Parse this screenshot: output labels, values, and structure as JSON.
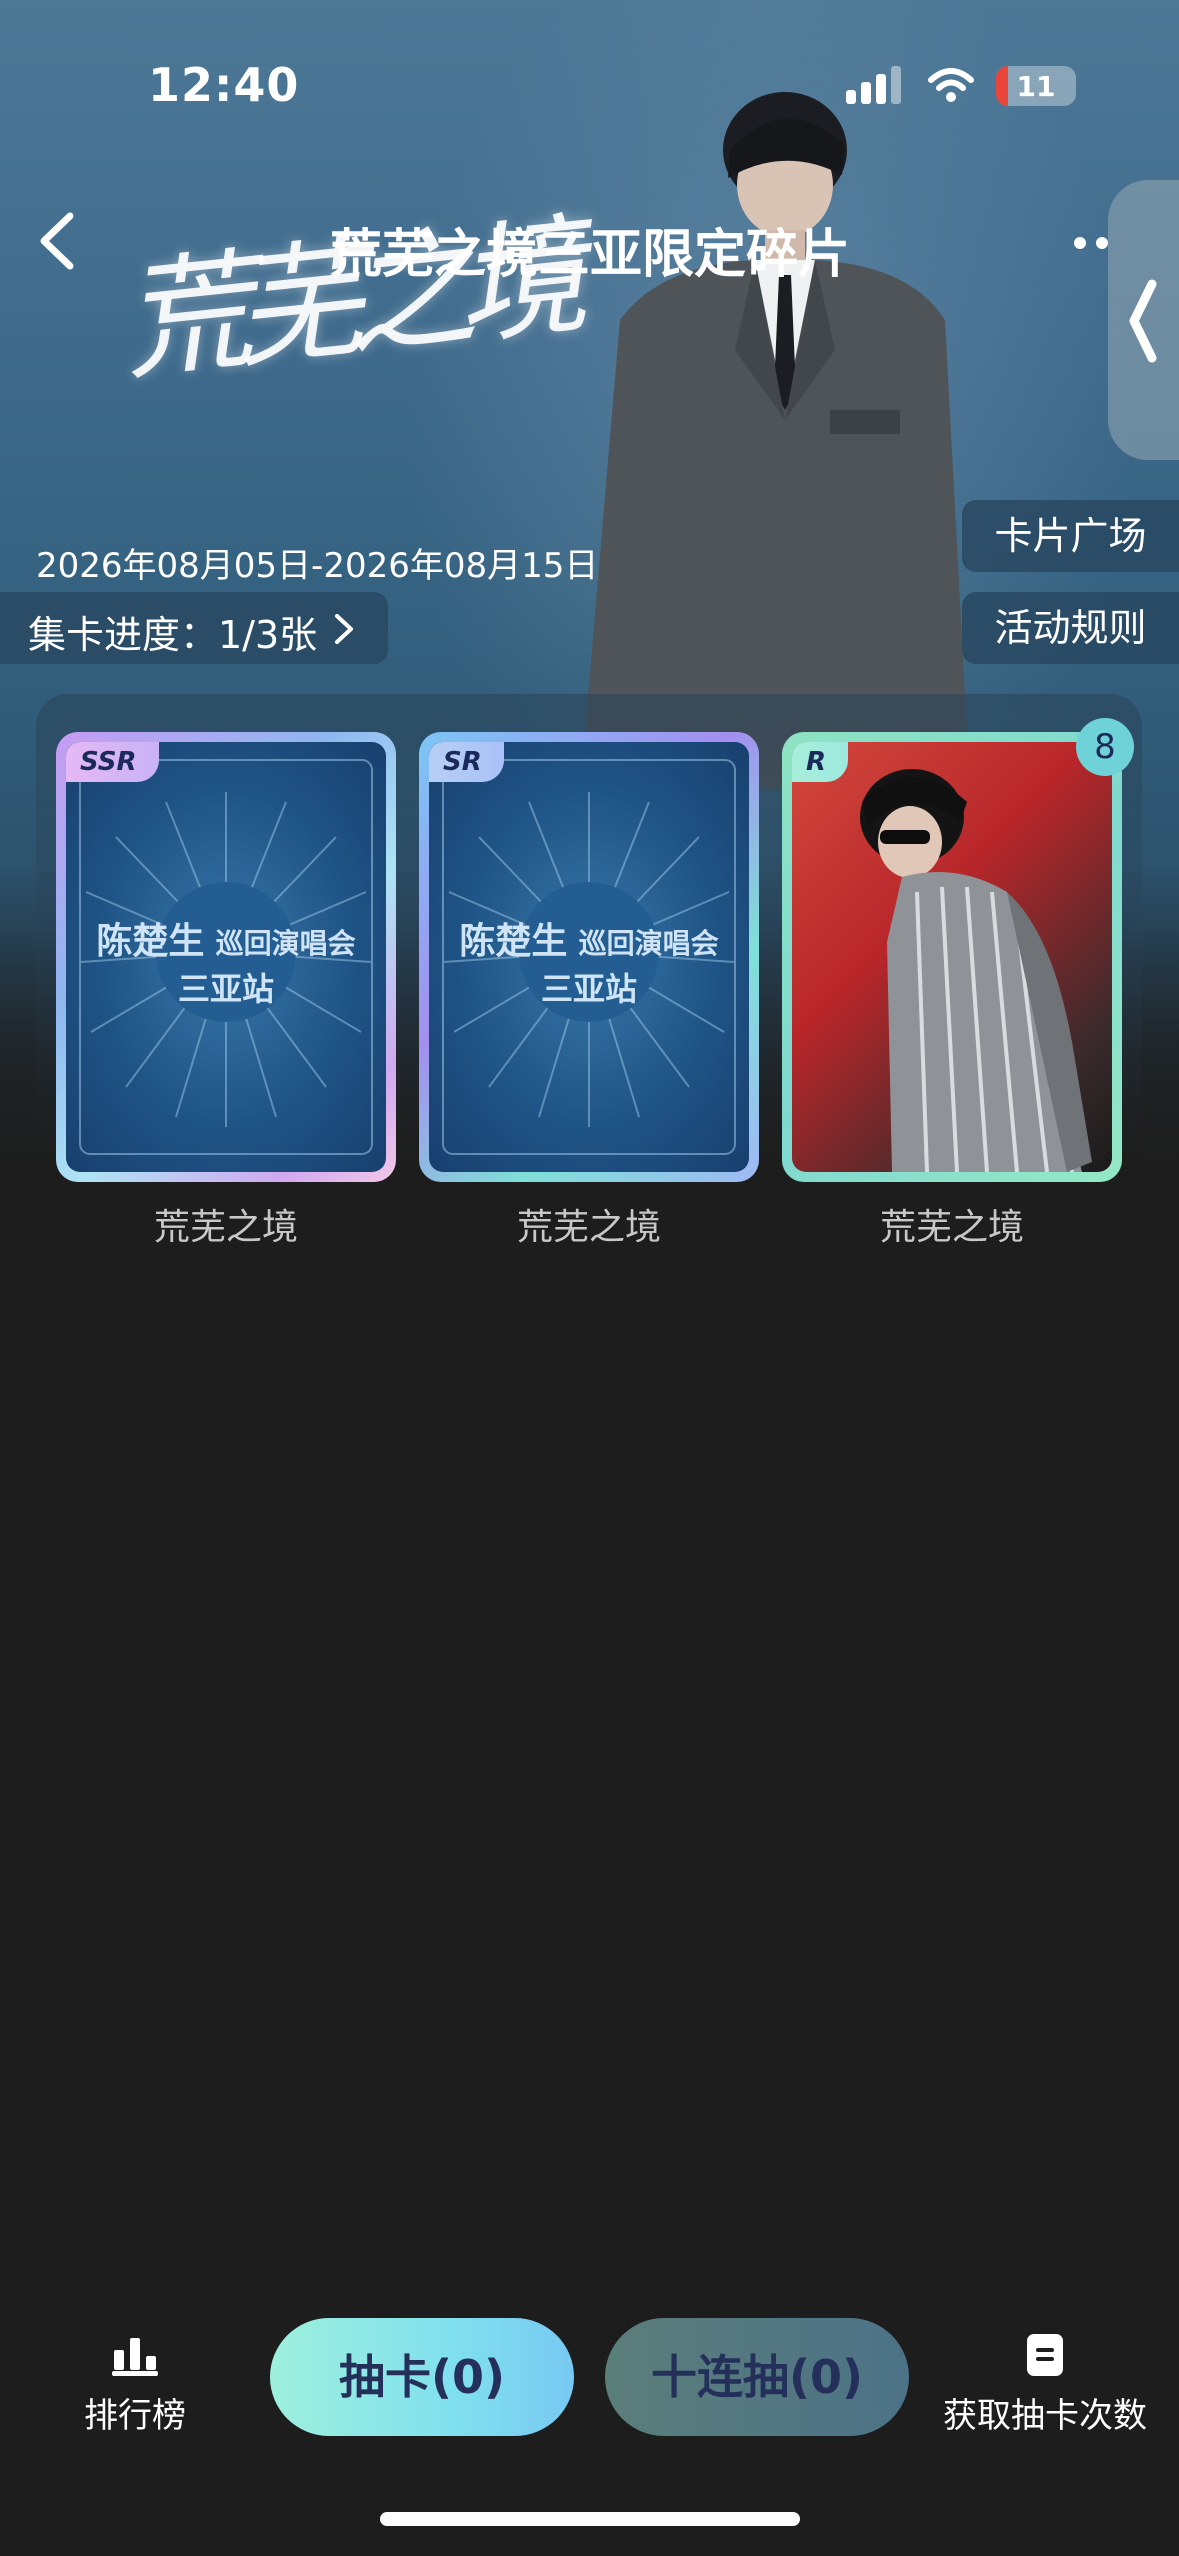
{
  "status_bar": {
    "time": "12:40",
    "battery": "11"
  },
  "header": {
    "title": "荒芜之境三亚限定碎片",
    "calligraphy": "荒芜之境",
    "date_range": "2026年08月05日-2026年08月15日",
    "progress_label": "集卡进度：1/3张",
    "plaza_button": "卡片广场",
    "rules_button": "活动规则"
  },
  "cards": [
    {
      "rarity": "SSR",
      "line1_a": "陈楚生",
      "line1_b": "巡回演唱会",
      "line2": "三亚站",
      "label": "荒芜之境"
    },
    {
      "rarity": "SR",
      "line1_a": "陈楚生",
      "line1_b": "巡回演唱会",
      "line2": "三亚站",
      "label": "荒芜之境"
    },
    {
      "rarity": "R",
      "count": "8",
      "label": "荒芜之境"
    }
  ],
  "bottom_bar": {
    "rank_label": "排行榜",
    "draw_button": "抽卡(0)",
    "ten_draw_button": "十连抽(0)",
    "get_draws_label": "获取抽卡次数"
  },
  "colors": {
    "page_background": "#1d1d1d",
    "draw_button_gradient": [
      "#9ef0dc",
      "#78c9f2"
    ],
    "ten_draw_gradient": [
      "#5b7e7a",
      "#4c7287"
    ]
  },
  "icons": [
    "back-arrow-icon",
    "more-dots-icon",
    "side-collapse-chevron-icon",
    "chevron-right-icon",
    "bar-chart-icon",
    "document-icon",
    "signal-icon",
    "wifi-icon",
    "battery-icon"
  ]
}
